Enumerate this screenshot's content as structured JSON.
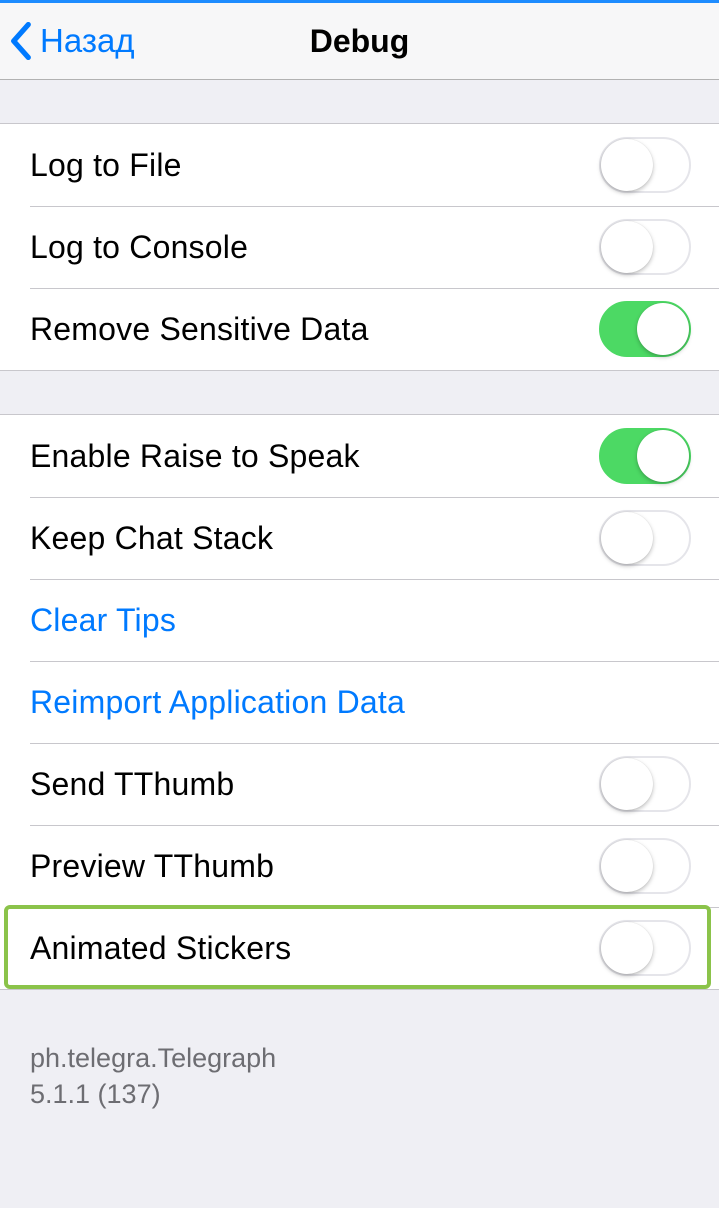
{
  "nav": {
    "back_label": "Назад",
    "title": "Debug"
  },
  "group1": [
    {
      "label": "Log to File",
      "type": "switch",
      "on": false
    },
    {
      "label": "Log to Console",
      "type": "switch",
      "on": false
    },
    {
      "label": "Remove Sensitive Data",
      "type": "switch",
      "on": true
    }
  ],
  "group2": [
    {
      "label": "Enable Raise to Speak",
      "type": "switch",
      "on": true
    },
    {
      "label": "Keep Chat Stack",
      "type": "switch",
      "on": false
    },
    {
      "label": "Clear Tips",
      "type": "link"
    },
    {
      "label": "Reimport Application Data",
      "type": "link"
    },
    {
      "label": "Send TThumb",
      "type": "switch",
      "on": false
    },
    {
      "label": "Preview TThumb",
      "type": "switch",
      "on": false
    },
    {
      "label": "Animated Stickers",
      "type": "switch",
      "on": false,
      "highlighted": true
    }
  ],
  "footer": {
    "bundle": "ph.telegra.Telegraph",
    "version": "5.1.1 (137)"
  },
  "colors": {
    "accent": "#007aff",
    "switch_on": "#4cd964",
    "highlight": "#8bc34a"
  }
}
